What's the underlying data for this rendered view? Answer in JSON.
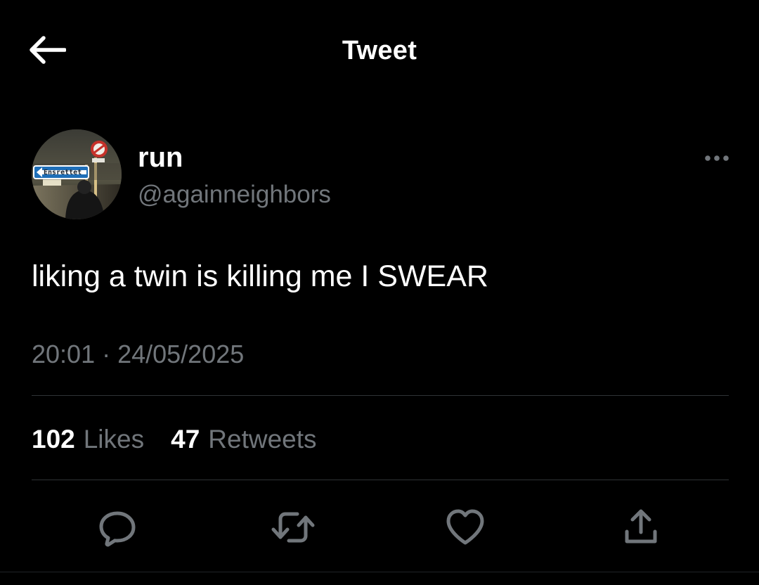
{
  "header": {
    "title": "Tweet",
    "back_icon": "arrow-left-icon"
  },
  "tweet": {
    "author": {
      "display_name": "run",
      "handle": "@againneighbors",
      "avatar": {
        "sign_text": "Ensrettet"
      }
    },
    "text": "liking a twin is killing me I SWEAR",
    "timestamp": "20:01 · 24/05/2025",
    "more_icon": "more-horizontal-icon"
  },
  "stats": {
    "likes_count": "102",
    "likes_label": "Likes",
    "retweets_count": "47",
    "retweets_label": "Retweets"
  },
  "actions": [
    {
      "name": "reply",
      "icon": "reply-icon"
    },
    {
      "name": "retweet",
      "icon": "retweet-icon"
    },
    {
      "name": "like",
      "icon": "heart-icon"
    },
    {
      "name": "share",
      "icon": "share-icon"
    }
  ],
  "colors": {
    "background": "#000000",
    "primary_text": "#ffffff",
    "secondary_text": "#71767b",
    "divider": "#2f3336",
    "icon": "#71767b"
  }
}
